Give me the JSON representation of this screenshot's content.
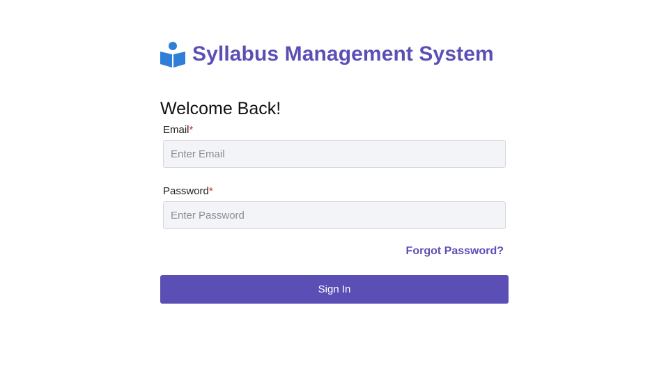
{
  "brand": {
    "icon": "reader-book-icon",
    "title": "Syllabus Management System"
  },
  "login": {
    "heading": "Welcome Back!",
    "email": {
      "label": "Email",
      "required_mark": "*",
      "placeholder": "Enter Email",
      "value": ""
    },
    "password": {
      "label": "Password",
      "required_mark": "*",
      "placeholder": "Enter Password",
      "value": ""
    },
    "forgot_password": "Forgot Password?",
    "submit_label": "Sign In"
  },
  "colors": {
    "accent": "#5b4fb6",
    "icon": "#2f7fd8",
    "required": "#e11d2a",
    "input_bg": "#f3f4f8"
  }
}
